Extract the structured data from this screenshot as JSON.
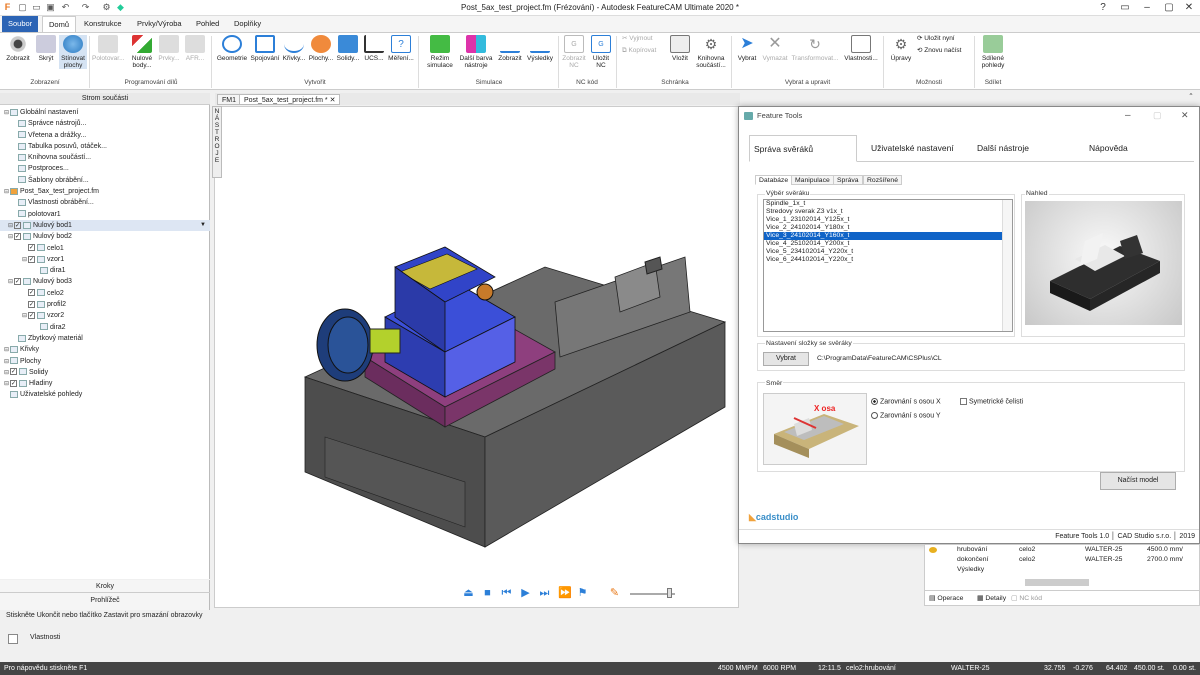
{
  "window": {
    "title": "Post_5ax_test_project.fm (Frézování) - Autodesk FeatureCAM Ultimate 2020 *"
  },
  "ribbon_tabs": [
    "Soubor",
    "Domů",
    "Konstrukce",
    "Prvky/Výroba",
    "Pohled",
    "Doplňky"
  ],
  "ribbon": {
    "zobrazeni": {
      "label": "Zobrazení",
      "buttons": [
        "Zobrazit",
        "Skrýt",
        "Stínovat plochy"
      ]
    },
    "programovani": {
      "label": "Programování dílů",
      "buttons": [
        "Polotovar...",
        "Nulové body...",
        "Prvky...",
        "AFR..."
      ]
    },
    "vytvorit": {
      "label": "Vytvořit",
      "buttons": [
        "Geometrie",
        "Spojování",
        "Křivky...",
        "Plochy...",
        "Solidy...",
        "UCS...",
        "Měření..."
      ]
    },
    "simulace": {
      "label": "Simulace",
      "buttons": [
        "Režim simulace",
        "Další barva nástroje",
        "Zobrazit",
        "Výsledky"
      ]
    },
    "nckod": {
      "label": "NC kód",
      "buttons": [
        "Zobrazit NC",
        "Uložit NC"
      ]
    },
    "schranka": {
      "label": "Schránka",
      "buttons": [
        "Vyjmout",
        "Kopírovat",
        "Vložit",
        "Knihovna součástí..."
      ]
    },
    "vybrat": {
      "label": "Vybrat a upravit",
      "buttons": [
        "Vybrat",
        "Vymazat",
        "Transformovat...",
        "Vlastnosti..."
      ]
    },
    "moznosti": {
      "label": "Možnosti",
      "buttons": [
        "Úpravy",
        "Uložit nyní",
        "Znovu načíst"
      ]
    },
    "sdilet": {
      "label": "Sdílet",
      "buttons": [
        "Sdílené pohledy"
      ]
    }
  },
  "left_panel": {
    "title": "Strom součásti",
    "tree": [
      "Globální nastavení",
      "Správce nástrojů...",
      "Vřetena a drážky...",
      "Tabulka posuvů, otáček...",
      "Knihovna součástí...",
      "Postproces...",
      "Šablony obrábění...",
      "Post_5ax_test_project.fm",
      "Vlastnosti obrábění...",
      "polotovar1",
      "Nulový bod1",
      "Nulový bod2",
      "celo1",
      "vzor1",
      "dira1",
      "Nulový bod3",
      "celo2",
      "profil2",
      "vzor2",
      "dira2",
      "Zbytkový materiál",
      "Křivky",
      "Plochy",
      "Solidy",
      "Hladiny",
      "Uživatelské pohledy"
    ],
    "bottom": [
      "Kroky",
      "Prohlížeč"
    ]
  },
  "doc_tabs": [
    "FM1",
    "Post_5ax_test_project.fm *"
  ],
  "side_tool": "NÁSTROJE",
  "dialog": {
    "title": "Feature Tools",
    "tabs": [
      "Správa svěráků",
      "Uživatelské nastavení",
      "Další nástroje",
      "Nápověda"
    ],
    "subtabs": [
      "Databáze",
      "Manipulace",
      "Správa",
      "Rozšířené"
    ],
    "vice_label": "Výběr svěráku",
    "preview_label": "Nahled",
    "vices": [
      "Spindle_1x_t",
      "Stredovy sverak Z3 v1x_t",
      "Vice_1_23102014_Y125x_t",
      "Vice_2_24102014_Y180x_t",
      "Vice_3_24102014_Y160x_t",
      "Vice_4_25102014_Y200x_t",
      "Vice_5_234102014_Y220x_t",
      "Vice_6_244102014_Y220x_t"
    ],
    "selected_index": 4,
    "folder_label": "Nastavení složky se svěráky",
    "browse": "Vybrat",
    "folder_path": "C:\\ProgramData\\FeatureCAM\\CSPlus\\CL",
    "direction_label": "Směr",
    "radio_x": "Zarovnání s osou X",
    "radio_y": "Zarovnání s osou Y",
    "symmetric": "Symetrické čelisti",
    "axis_label": "X osa",
    "load_button": "Načíst model",
    "brand": "cadstudio",
    "footer": [
      "Feature Tools 1.0",
      "CAD Studio s.r.o.",
      "2019"
    ]
  },
  "operations": {
    "rows": [
      [
        "hrubování",
        "celo2",
        "WALTER-25",
        "4500.0 mm/"
      ],
      [
        "dokončení",
        "celo2",
        "WALTER-25",
        "2700.0 mm/"
      ],
      [
        "Výsledky",
        "",
        "",
        ""
      ]
    ],
    "tabs": [
      "Operace",
      "Detaily",
      "NC kód"
    ]
  },
  "status_message": "Stiskněte Ukončit nebo tlačítko Zastavit pro smazání obrazovky",
  "properties_label": "Vlastnosti",
  "statusbar": {
    "help": "Pro nápovědu stiskněte F1",
    "feed": "4500 MMPM",
    "rpm": "6000 RPM",
    "time": "12:11.5",
    "op": "celo2:hrubování",
    "tool": "WALTER-25",
    "x": "32.755",
    "y": "-0.276",
    "z": "64.402",
    "f": "450.00 st.",
    "extra": "0.00 st."
  },
  "colors": {
    "accent": "#2c64b5",
    "selection": "#0f63c7"
  }
}
